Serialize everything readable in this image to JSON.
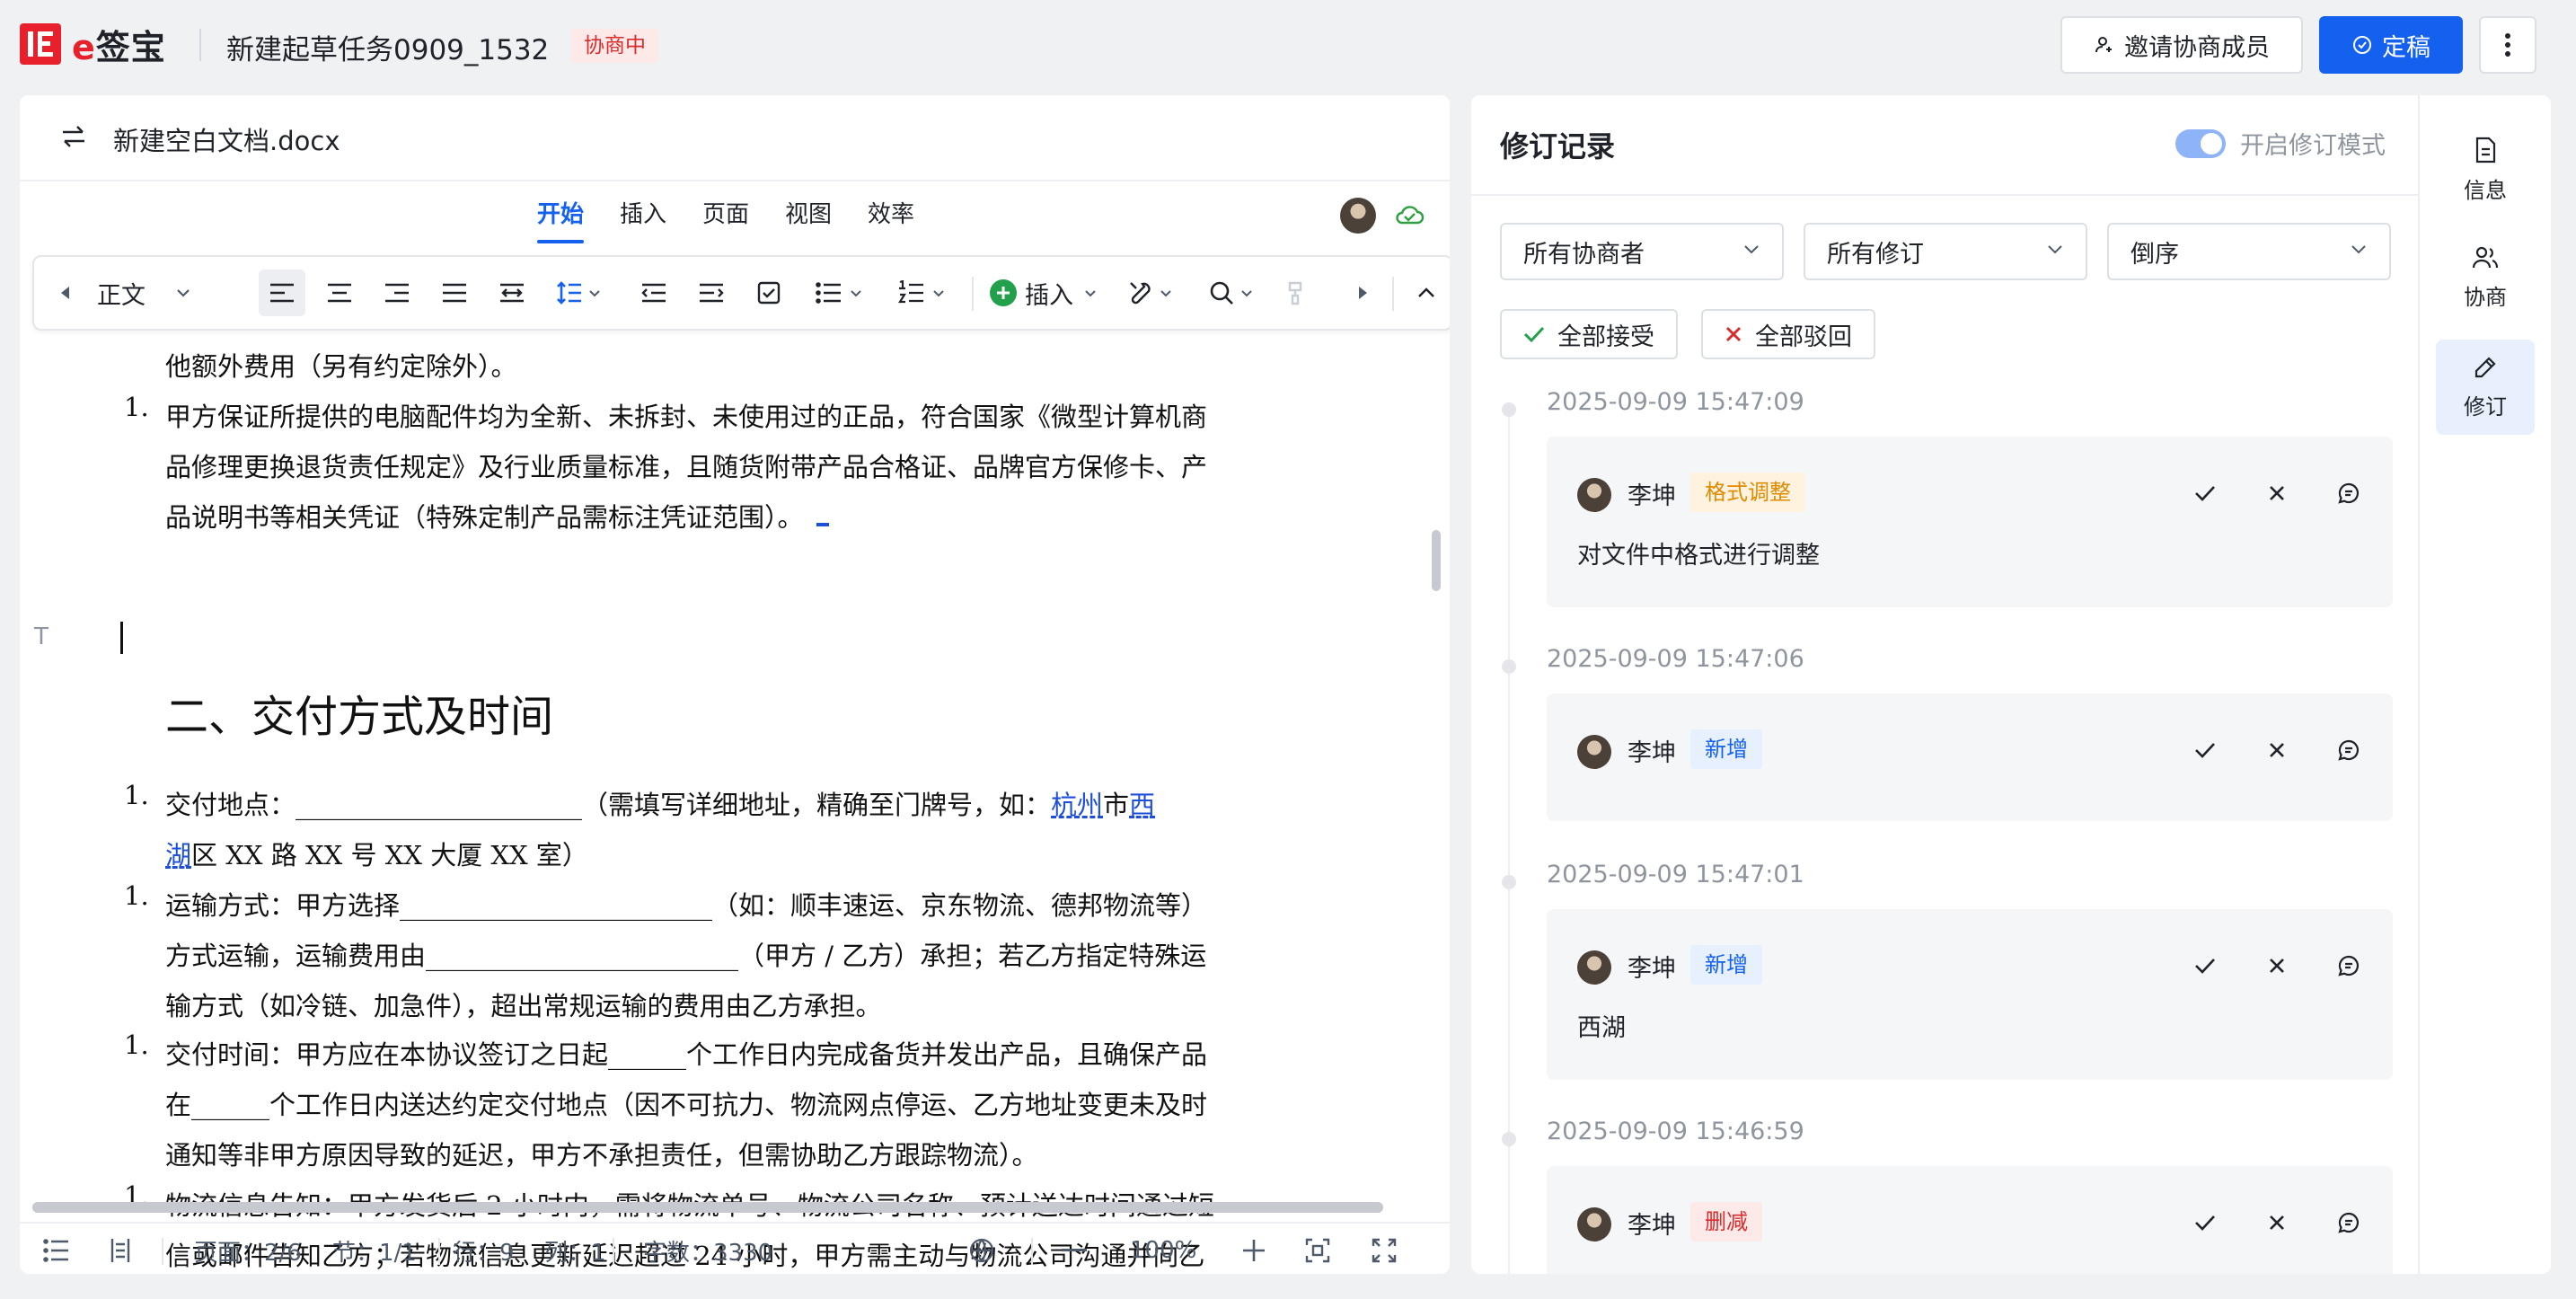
{
  "header": {
    "logo_text": "e签宝",
    "doc_title": "新建起草任务0909_1532",
    "status": "协商中",
    "invite_button": "邀请协商成员",
    "finalize_button": "定稿"
  },
  "editor": {
    "file_name": "新建空白文档.docx",
    "menu_tabs": [
      "开始",
      "插入",
      "页面",
      "视图",
      "效率"
    ],
    "active_tab": "开始",
    "toolbar": {
      "style_value": "正文",
      "insert_label": "插入"
    },
    "document": {
      "line_top": "他额外费用（另有约定除外）。",
      "item1": {
        "num": "1.",
        "lines": [
          "甲方保证所提供的电脑配件均为全新、未拆封、未使用过的正品，符合国家《微型计算机商",
          "品修理更换退货责任规定》及行业质量标准，且随货附带产品合格证、品牌官方保修卡、产",
          "品说明书等相关凭证（特殊定制产品需标注凭证范围）。"
        ]
      },
      "heading": "二、交付方式及时间",
      "item2": {
        "num": "1.",
        "line1_a": "交付地点：______________________（需填写详细地址，精确至门牌号，如：",
        "line1_ins1": "杭州",
        "line1_b": "市",
        "line1_ins2": "西",
        "line2_ins": "湖",
        "line2_rest": "区 XX 路 XX 号 XX 大厦 XX 室）"
      },
      "item3": {
        "num": "1.",
        "lines": [
          "运输方式：甲方选择________________________（如：顺丰速运、京东物流、德邦物流等）",
          "方式运输，运输费用由________________________（甲方 / 乙方）承担；若乙方指定特殊运",
          "输方式（如冷链、加急件），超出常规运输的费用由乙方承担。"
        ]
      },
      "item4": {
        "num": "1.",
        "lines": [
          "交付时间：甲方应在本协议签订之日起______个工作日内完成备货并发出产品，且确保产品",
          "在______个工作日内送达约定交付地点（因不可抗力、物流网点停运、乙方地址变更未及时",
          "通知等非甲方原因导致的延迟，甲方不承担责任，但需协助乙方跟踪物流）。"
        ]
      },
      "item5": {
        "num": "1.",
        "lines": [
          "物流信息告知：甲方发货后 2 小时内，需将物流单号、物流公司名称、预计送达时间通过短",
          "信或邮件告知乙方；若物流信息更新延迟超过 24 小时，甲方需主动与物流公司沟通并向乙"
        ]
      }
    },
    "statusbar": {
      "page": "页面：2/6",
      "section": "节：1/1",
      "row": "行：9",
      "col": "列：1",
      "words": "字数：3330",
      "zoom": "100%"
    }
  },
  "revisions": {
    "title": "修订记录",
    "toggle_label": "开启修订模式",
    "toggle_on": true,
    "filters": [
      "所有协商者",
      "所有修订",
      "倒序"
    ],
    "accept_all": "全部接受",
    "reject_all": "全部驳回",
    "items": [
      {
        "time": "2025-09-09 15:47:09",
        "user": "李坤",
        "tag": "格式调整",
        "tag_type": "format",
        "content": "对文件中格式进行调整"
      },
      {
        "time": "2025-09-09 15:47:06",
        "user": "李坤",
        "tag": "新增",
        "tag_type": "add",
        "content": ""
      },
      {
        "time": "2025-09-09 15:47:01",
        "user": "李坤",
        "tag": "新增",
        "tag_type": "add",
        "content": "西湖"
      },
      {
        "time": "2025-09-09 15:46:59",
        "user": "李坤",
        "tag": "删减",
        "tag_type": "delete",
        "content": ""
      }
    ]
  },
  "sidebar": {
    "items": [
      "信息",
      "协商",
      "修订"
    ],
    "active": "修订"
  },
  "colors": {
    "brand_red": "#e7202b",
    "primary_blue": "#1461f0",
    "insert_blue": "#1e4fd8",
    "tag_format": "#e08a00",
    "tag_delete": "#d92c2c"
  }
}
